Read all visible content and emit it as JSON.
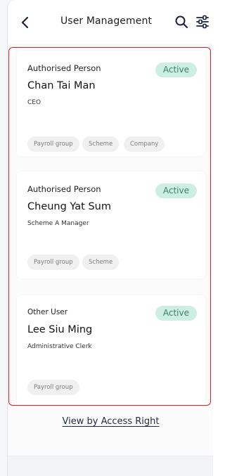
{
  "header": {
    "title": "User Management",
    "back_icon": "chevron-left-icon",
    "search_icon": "search-icon",
    "filter_icon": "sliders-icon"
  },
  "users": [
    {
      "role": "Authorised Person",
      "name": "Chan Tai Man",
      "title": "CEO",
      "status": "Active",
      "tags": [
        "Payroll group",
        "Scheme",
        "Company"
      ]
    },
    {
      "role": "Authorised Person",
      "name": "Cheung Yat Sum",
      "title": "Scheme A Manager",
      "status": "Active",
      "tags": [
        "Payroll group",
        "Scheme"
      ]
    },
    {
      "role": "Other User",
      "name": "Lee Siu Ming",
      "title": "Administrative Clerk",
      "status": "Active",
      "tags": [
        "Payroll group"
      ]
    }
  ],
  "footer": {
    "view_link": "View by Access Right"
  },
  "colors": {
    "status_badge_bg": "#cdeee3",
    "status_badge_text": "#3a7f6e",
    "highlight_border": "#d9202a"
  }
}
